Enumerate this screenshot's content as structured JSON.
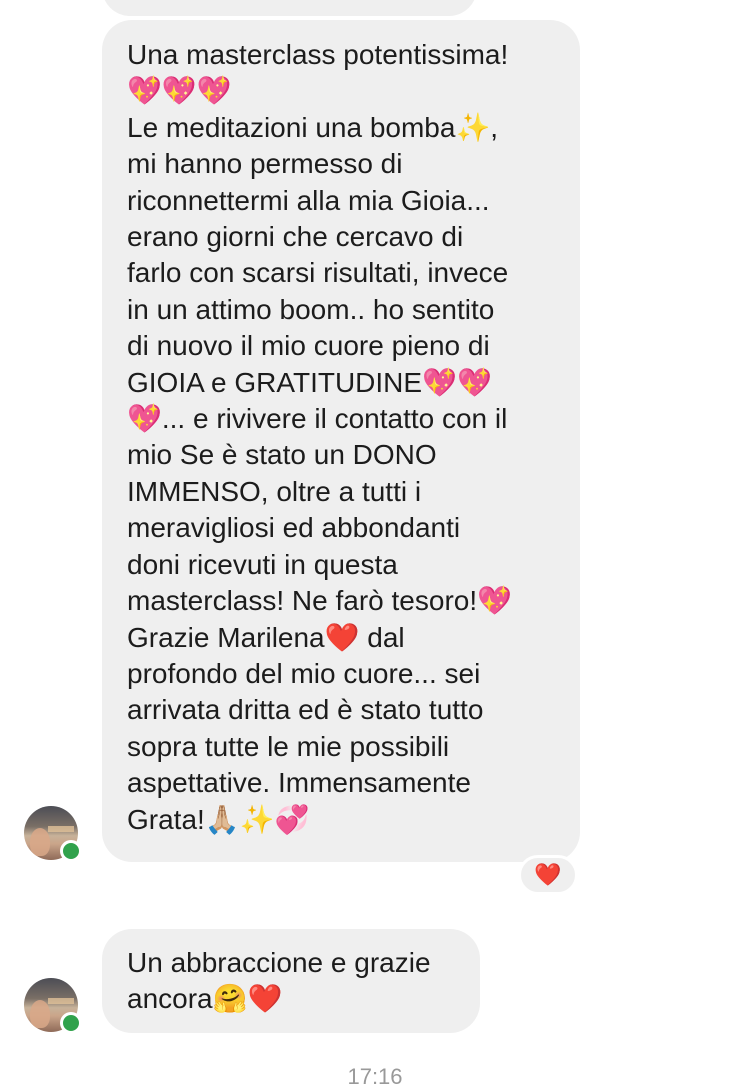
{
  "conversation": {
    "message_main": {
      "lines": [
        "Una masterclass potentissima!",
        "💖💖💖",
        "Le meditazioni una bomba✨,",
        "mi hanno permesso di",
        "riconnettermi alla mia Gioia...",
        "erano giorni che cercavo di",
        "farlo con scarsi risultati, invece",
        "in un attimo boom.. ho sentito",
        "di nuovo il mio cuore pieno di",
        "GIOIA e GRATITUDINE💖💖",
        "💖... e rivivere il contatto con il",
        "mio Se è stato un DONO",
        "IMMENSO, oltre a tutti i",
        "meravigliosi ed abbondanti",
        "doni ricevuti in questa",
        "masterclass! Ne farò tesoro!💖",
        "Grazie Marilena❤️ dal",
        "profondo del mio cuore... sei",
        "arrivata dritta ed è stato tutto",
        "sopra tutte le mie possibili",
        "aspettative. Immensamente",
        "Grata!🙏🏼✨💞"
      ],
      "reaction": "❤️"
    },
    "message_second": {
      "lines": [
        "Un abbraccione e grazie",
        "ancora🤗❤️"
      ]
    },
    "timestamp": "17:16",
    "colors": {
      "bubble": "#efefef",
      "text": "#1c1c1c",
      "presence": "#31a24c",
      "timestamp": "#999999"
    },
    "icons": {
      "presence": "online-status-dot",
      "reaction": "heart-icon"
    }
  }
}
